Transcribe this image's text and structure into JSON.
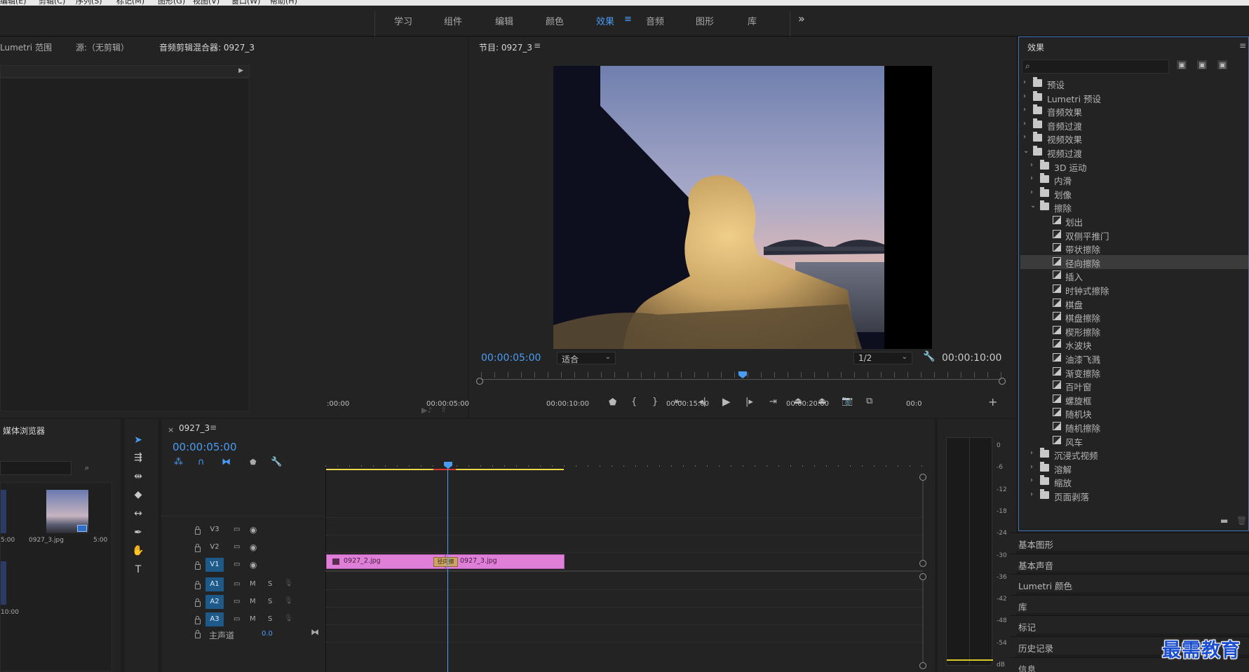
{
  "menubar": [
    "编辑(E)",
    "剪辑(C)",
    "序列(S)",
    "标记(M)",
    "图形(G)",
    "视图(V)",
    "窗口(W)",
    "帮助(H)"
  ],
  "workspaces": {
    "items": [
      "学习",
      "组件",
      "编辑",
      "颜色",
      "效果",
      "音频",
      "图形",
      "库"
    ],
    "active": "效果",
    "more_icon": "»"
  },
  "source_panel": {
    "tabs": [
      "Lumetri 范围",
      "源:（无剪辑）",
      "音频剪辑混合器: 0927_3"
    ]
  },
  "program_monitor": {
    "title": "节目: 0927_3",
    "menu_icon": "≡",
    "current_time": "00:00:05:00",
    "fit_value": "适合",
    "resolution": "1/2",
    "duration": "00:00:10:00"
  },
  "media_browser": {
    "title": "媒体浏览器",
    "items": [
      {
        "name": "",
        "duration": "5:00"
      },
      {
        "name": "0927_3.jpg",
        "duration": "5:00"
      },
      {
        "name": "",
        "duration": "10:00"
      }
    ]
  },
  "timeline": {
    "close_icon": "×",
    "sequence": "0927_3",
    "current_time": "00:00:05:00",
    "ruler": [
      ":00:00",
      "00:00:05:00",
      "00:00:10:00",
      "00:00:15:00",
      "00:00:20:00",
      "00:0"
    ],
    "tracks": {
      "video": [
        "V3",
        "V2",
        "V1"
      ],
      "audio": [
        "A1",
        "A2",
        "A3"
      ],
      "master": "主声道",
      "master_value": "0.0"
    },
    "mute": "M",
    "solo": "S",
    "clips": [
      {
        "name": "0927_2.jpg"
      },
      {
        "name": "0927_3.jpg"
      }
    ],
    "transition_label": "径向擦"
  },
  "audio_meter": {
    "labels": [
      "0",
      "-6",
      "-12",
      "-18",
      "-24",
      "-30",
      "-36",
      "-42",
      "-48",
      "-54",
      "dB"
    ]
  },
  "effects_panel": {
    "title": "效果",
    "menu_icon": "≡",
    "search_placeholder": "",
    "tree": [
      {
        "label": "预设",
        "level": 0,
        "type": "folder",
        "expanded": false
      },
      {
        "label": "Lumetri 预设",
        "level": 0,
        "type": "folder",
        "expanded": false
      },
      {
        "label": "音频效果",
        "level": 0,
        "type": "folder",
        "expanded": false
      },
      {
        "label": "音频过渡",
        "level": 0,
        "type": "folder",
        "expanded": false
      },
      {
        "label": "视频效果",
        "level": 0,
        "type": "folder",
        "expanded": false
      },
      {
        "label": "视频过渡",
        "level": 0,
        "type": "folder",
        "expanded": true
      },
      {
        "label": "3D 运动",
        "level": 1,
        "type": "folder",
        "expanded": false
      },
      {
        "label": "内滑",
        "level": 1,
        "type": "folder",
        "expanded": false
      },
      {
        "label": "划像",
        "level": 1,
        "type": "folder",
        "expanded": false
      },
      {
        "label": "擦除",
        "level": 1,
        "type": "folder",
        "expanded": true
      },
      {
        "label": "划出",
        "level": 2,
        "type": "effect"
      },
      {
        "label": "双侧平推门",
        "level": 2,
        "type": "effect"
      },
      {
        "label": "带状擦除",
        "level": 2,
        "type": "effect"
      },
      {
        "label": "径向擦除",
        "level": 2,
        "type": "effect",
        "selected": true
      },
      {
        "label": "插入",
        "level": 2,
        "type": "effect"
      },
      {
        "label": "时钟式擦除",
        "level": 2,
        "type": "effect"
      },
      {
        "label": "棋盘",
        "level": 2,
        "type": "effect"
      },
      {
        "label": "棋盘擦除",
        "level": 2,
        "type": "effect"
      },
      {
        "label": "楔形擦除",
        "level": 2,
        "type": "effect"
      },
      {
        "label": "水波块",
        "level": 2,
        "type": "effect"
      },
      {
        "label": "油漆飞溅",
        "level": 2,
        "type": "effect"
      },
      {
        "label": "渐变擦除",
        "level": 2,
        "type": "effect"
      },
      {
        "label": "百叶窗",
        "level": 2,
        "type": "effect"
      },
      {
        "label": "螺旋框",
        "level": 2,
        "type": "effect"
      },
      {
        "label": "随机块",
        "level": 2,
        "type": "effect"
      },
      {
        "label": "随机擦除",
        "level": 2,
        "type": "effect"
      },
      {
        "label": "风车",
        "level": 2,
        "type": "effect"
      },
      {
        "label": "沉浸式视频",
        "level": 1,
        "type": "folder",
        "expanded": false
      },
      {
        "label": "溶解",
        "level": 1,
        "type": "folder",
        "expanded": false
      },
      {
        "label": "缩放",
        "level": 1,
        "type": "folder",
        "expanded": false
      },
      {
        "label": "页面剥落",
        "level": 1,
        "type": "folder",
        "expanded": false
      }
    ]
  },
  "stacked_panels": [
    "基本图形",
    "基本声音",
    "Lumetri 颜色",
    "库",
    "标记",
    "历史记录",
    "信息"
  ],
  "watermark": "最需教育",
  "colors": {
    "accent": "#4a9cf3",
    "clip": "#e07fd8",
    "background": "#232323"
  }
}
